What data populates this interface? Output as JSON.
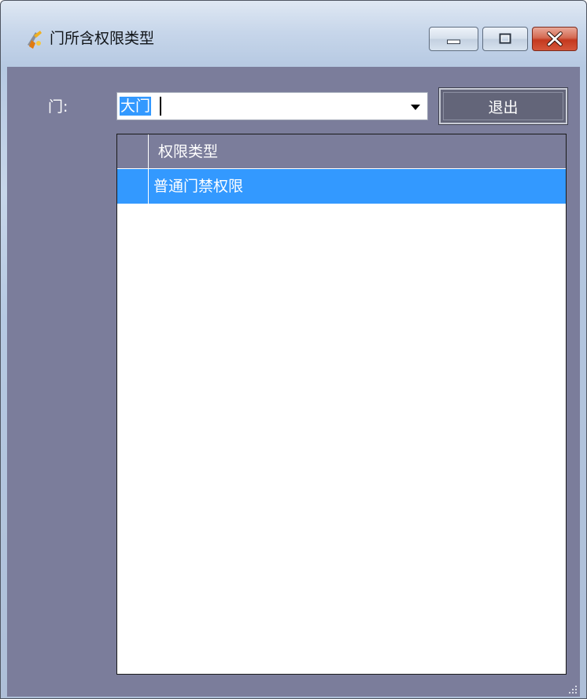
{
  "window": {
    "title": "门所含权限类型",
    "controls": {
      "minimize": "minimize",
      "maximize": "maximize",
      "close": "close"
    }
  },
  "form": {
    "door_label": "门:",
    "door_value": "大门",
    "exit_label": "退出"
  },
  "grid": {
    "columns": [
      "权限类型"
    ],
    "rows": [
      {
        "权限类型": "普通门禁权限",
        "selected": true
      }
    ]
  },
  "colors": {
    "client_bg": "#7b7d9b",
    "selection": "#3399ff",
    "close_button": "#c4391f"
  },
  "icons": [
    "app-icon",
    "minimize-icon",
    "maximize-icon",
    "close-icon",
    "dropdown-arrow-icon",
    "resize-grip-icon"
  ]
}
